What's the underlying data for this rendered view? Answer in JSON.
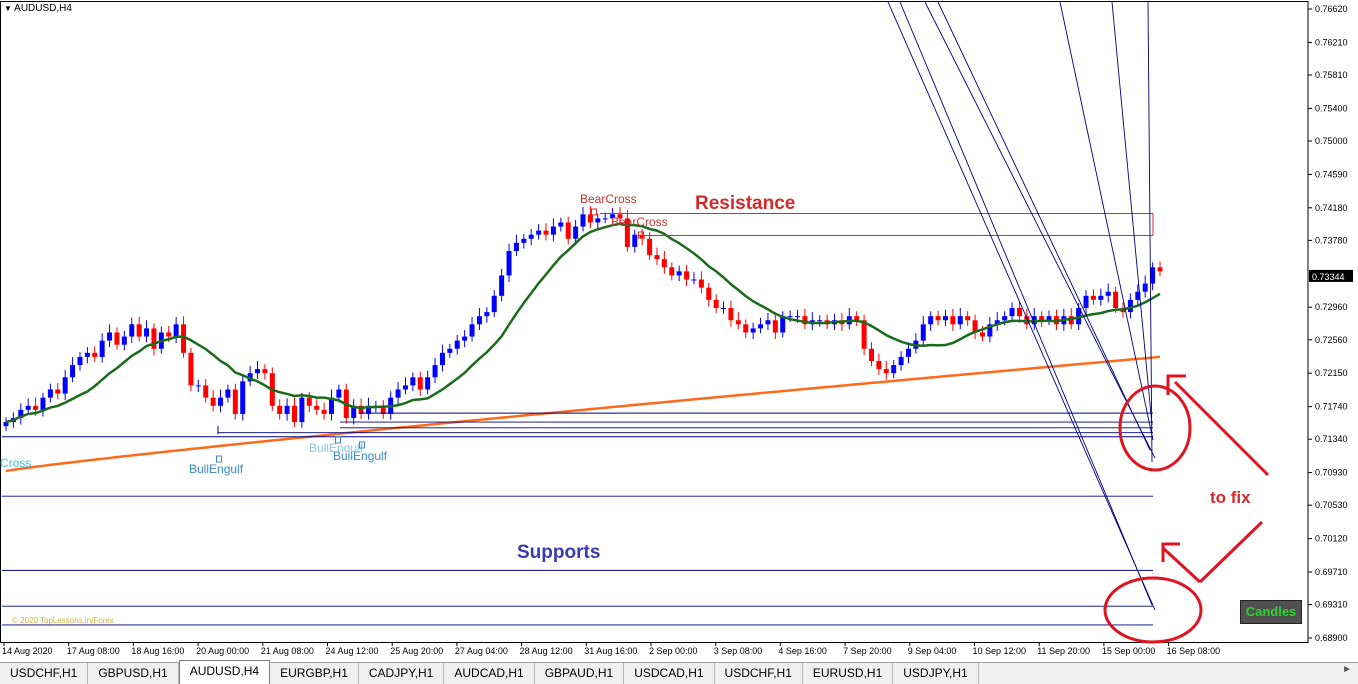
{
  "window": {
    "symbol_title": "AUDUSD,H4",
    "watermark": "© 2020 TopLessons.in/Forex",
    "candles_badge": "Candles"
  },
  "annotations": {
    "resistance": "Resistance",
    "supports": "Supports",
    "to_fix": "to fix",
    "bearcross_1": "BearCross",
    "bearcross_2": "BearCross",
    "bullengulf_1": "BullEngulf",
    "bullengulf_2": "BullEngulf",
    "bullengulf_faded": "BullEngulf",
    "cross_left": "Cross"
  },
  "colors": {
    "bull_candle": "#0000ff",
    "bear_candle": "#ff0000",
    "ma_fast": "#1a6b1a",
    "ma_slow": "#ff6a1a",
    "resistance_line": "#c83232",
    "support_line": "#000080",
    "annotation_red": "#d42a2a",
    "annotation_blue": "#3a3ab0",
    "signal_text": "#3a8ac8",
    "bearcross_text": "#c83232",
    "circle_red": "#e0141e"
  },
  "chart_data": {
    "type": "candlestick",
    "symbol": "AUDUSD",
    "timeframe": "H4",
    "y_ticks": [
      "0.76620",
      "0.76210",
      "0.75810",
      "0.75400",
      "0.75000",
      "0.74590",
      "0.74180",
      "0.73780",
      "0.73344",
      "0.72960",
      "0.72560",
      "0.72150",
      "0.71740",
      "0.71340",
      "0.70930",
      "0.70530",
      "0.70120",
      "0.69710",
      "0.69310",
      "0.68900"
    ],
    "current_price": "0.73344",
    "x_ticks": [
      "14 Aug 2020",
      "17 Aug 08:00",
      "18 Aug 16:00",
      "20 Aug 00:00",
      "21 Aug 08:00",
      "24 Aug 12:00",
      "25 Aug 20:00",
      "27 Aug 04:00",
      "28 Aug 12:00",
      "31 Aug 16:00",
      "2 Sep 00:00",
      "3 Sep 08:00",
      "4 Sep 16:00",
      "7 Sep 20:00",
      "9 Sep 04:00",
      "10 Sep 12:00",
      "11 Sep 20:00",
      "15 Sep 00:00",
      "16 Sep 08:00"
    ],
    "closes": [
      0.7155,
      0.716,
      0.717,
      0.7175,
      0.717,
      0.7185,
      0.7195,
      0.719,
      0.721,
      0.7225,
      0.7235,
      0.724,
      0.7235,
      0.7255,
      0.7265,
      0.725,
      0.726,
      0.7275,
      0.726,
      0.727,
      0.7245,
      0.7265,
      0.726,
      0.7275,
      0.724,
      0.72,
      0.72,
      0.7185,
      0.7175,
      0.7185,
      0.7195,
      0.7165,
      0.7205,
      0.7215,
      0.722,
      0.7215,
      0.7175,
      0.7165,
      0.7175,
      0.7155,
      0.7185,
      0.7175,
      0.717,
      0.7165,
      0.7185,
      0.7195,
      0.716,
      0.7175,
      0.7165,
      0.7175,
      0.7175,
      0.7165,
      0.7185,
      0.7195,
      0.72,
      0.721,
      0.7195,
      0.721,
      0.7225,
      0.724,
      0.7245,
      0.7255,
      0.726,
      0.7275,
      0.7285,
      0.729,
      0.731,
      0.7335,
      0.7365,
      0.7375,
      0.738,
      0.7385,
      0.739,
      0.7385,
      0.7395,
      0.74,
      0.738,
      0.7395,
      0.741,
      0.74,
      0.7405,
      0.7405,
      0.741,
      0.7405,
      0.737,
      0.7385,
      0.738,
      0.736,
      0.7355,
      0.7345,
      0.7335,
      0.734,
      0.733,
      0.733,
      0.732,
      0.7305,
      0.7295,
      0.7295,
      0.728,
      0.7275,
      0.7265,
      0.727,
      0.7275,
      0.728,
      0.7265,
      0.7285,
      0.7285,
      0.7285,
      0.7275,
      0.728,
      0.728,
      0.7275,
      0.728,
      0.7275,
      0.7285,
      0.728,
      0.7245,
      0.723,
      0.722,
      0.7215,
      0.7225,
      0.7235,
      0.7245,
      0.7255,
      0.7275,
      0.7285,
      0.728,
      0.7285,
      0.7275,
      0.7285,
      0.728,
      0.7265,
      0.726,
      0.7275,
      0.728,
      0.7285,
      0.7295,
      0.7285,
      0.7275,
      0.7285,
      0.728,
      0.7285,
      0.7275,
      0.7285,
      0.7275,
      0.7295,
      0.731,
      0.7305,
      0.731,
      0.7315,
      0.7295,
      0.729,
      0.7305,
      0.7315,
      0.7325,
      0.7345,
      0.734
    ],
    "overlays": [
      {
        "type": "moving-average",
        "color": "green"
      },
      {
        "type": "moving-average",
        "color": "orange"
      }
    ],
    "horizontal_levels": {
      "resistance": [
        0.7411,
        0.7384
      ],
      "support": [
        0.7166,
        0.7155,
        0.7148,
        0.7142,
        0.7137,
        0.7064,
        0.6973,
        0.6929,
        0.6906
      ]
    },
    "labeled_signals": [
      {
        "label": "BearCross",
        "near": "31 Aug 16:00"
      },
      {
        "label": "BearCross",
        "near": "2 Sep 00:00"
      },
      {
        "label": "BullEngulf",
        "near": "20 Aug 00:00"
      },
      {
        "label": "BullEngulf",
        "near": "24 Aug 12:00"
      }
    ],
    "title": "AUDUSD,H4"
  },
  "tabs": [
    {
      "label": "USDCHF,H1",
      "active": false
    },
    {
      "label": "GBPUSD,H1",
      "active": false
    },
    {
      "label": "AUDUSD,H4",
      "active": true
    },
    {
      "label": "EURGBP,H1",
      "active": false
    },
    {
      "label": "CADJPY,H1",
      "active": false
    },
    {
      "label": "AUDCAD,H1",
      "active": false
    },
    {
      "label": "GBPAUD,H1",
      "active": false
    },
    {
      "label": "USDCAD,H1",
      "active": false
    },
    {
      "label": "USDCHF,H1",
      "active": false
    },
    {
      "label": "EURUSD,H1",
      "active": false
    },
    {
      "label": "USDJPY,H1",
      "active": false
    }
  ],
  "tab_scroll_icon": "arrow-right-icon"
}
